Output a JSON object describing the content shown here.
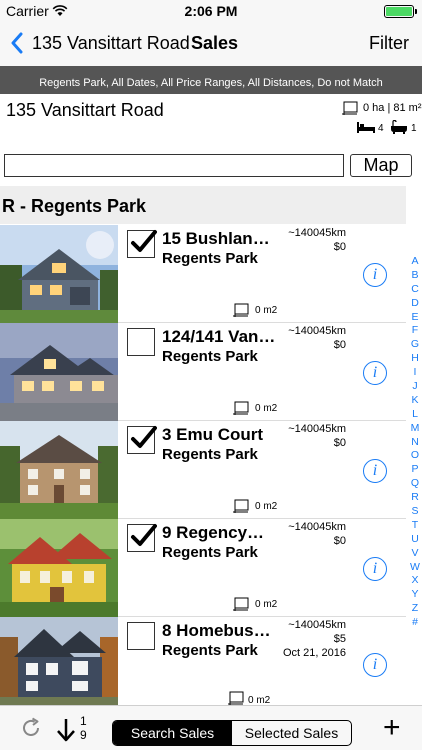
{
  "status_bar": {
    "carrier": "Carrier",
    "time": "2:06 PM"
  },
  "nav": {
    "title": "135 Vansittart Road",
    "subtitle": "Sales",
    "filter_label": "Filter"
  },
  "filter_summary": "Regents Park, All Dates, All Price Ranges, All Distances, Do not Match",
  "property": {
    "address": "135 Vansittart Road",
    "area": "0 ha | 81 m²",
    "bedrooms": "4",
    "bathrooms": "1"
  },
  "search": {
    "value": "",
    "placeholder": "",
    "map_label": "Map"
  },
  "section": {
    "header": "R - Regents Park"
  },
  "listings": [
    {
      "title": "15 Bushlan…",
      "suburb": "Regents Park",
      "distance": "~140045km",
      "price": "$0",
      "date": "",
      "area": "0 m2",
      "checked": true
    },
    {
      "title": "124/141 Van…",
      "suburb": "Regents Park",
      "distance": "~140045km",
      "price": "$0",
      "date": "",
      "area": "0 m2",
      "checked": false
    },
    {
      "title": "3 Emu Court",
      "suburb": "Regents Park",
      "distance": "~140045km",
      "price": "$0",
      "date": "",
      "area": "0 m2",
      "checked": true
    },
    {
      "title": "9 Regency…",
      "suburb": "Regents Park",
      "distance": "~140045km",
      "price": "$0",
      "date": "",
      "area": "0 m2",
      "checked": true
    },
    {
      "title": "8 Homebus…",
      "suburb": "Regents Park",
      "distance": "~140045km",
      "price": "$5",
      "date": "Oct 21, 2016",
      "area": "0 m2",
      "checked": false
    }
  ],
  "index_letters": [
    "A",
    "B",
    "C",
    "D",
    "E",
    "F",
    "G",
    "H",
    "I",
    "J",
    "K",
    "L",
    "M",
    "N",
    "O",
    "P",
    "Q",
    "R",
    "S",
    "T",
    "U",
    "V",
    "W",
    "X",
    "Y",
    "Z",
    "#"
  ],
  "toolbar": {
    "sort_top": "1",
    "sort_bottom": "9",
    "search_sales": "Search Sales",
    "selected_sales": "Selected Sales",
    "add": "+"
  },
  "colors": {
    "accent": "#1a7cf5",
    "filter_bar": "#555555",
    "battery": "#4cd964"
  }
}
